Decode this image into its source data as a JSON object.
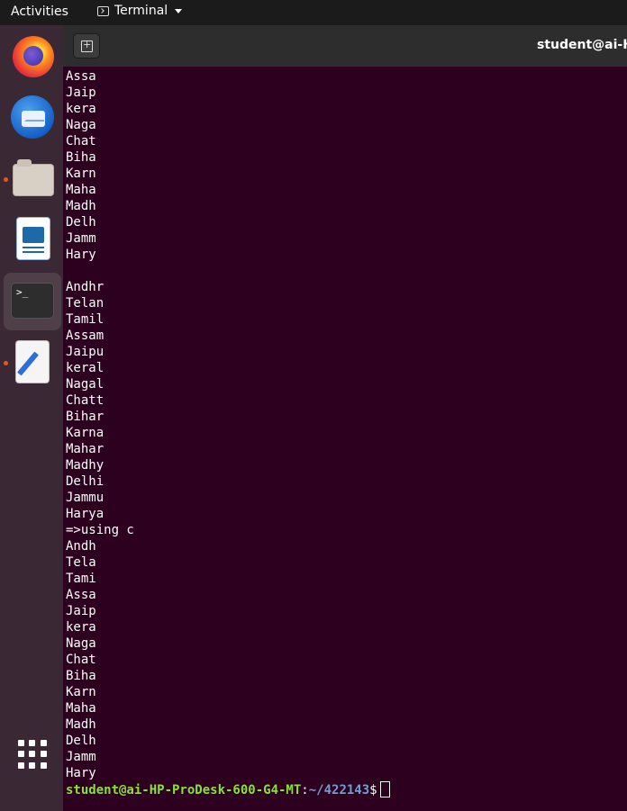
{
  "topbar": {
    "activities": "Activities",
    "app_name": "Terminal"
  },
  "dock": {
    "items": [
      {
        "name": "Firefox",
        "icon": "firefox-icon",
        "running": false
      },
      {
        "name": "Thunderbird",
        "icon": "thunderbird-icon",
        "running": false
      },
      {
        "name": "Files",
        "icon": "folder-icon",
        "running": true
      },
      {
        "name": "LibreOffice Writer",
        "icon": "writer-icon",
        "running": false
      },
      {
        "name": "Terminal",
        "icon": "terminal-icon",
        "running": true,
        "active": true
      },
      {
        "name": "Text Editor",
        "icon": "text-editor-icon",
        "running": true
      }
    ],
    "show_apps_icon": "grid-icon",
    "terminal_glyph": ">_"
  },
  "header": {
    "title": "student@ai-H"
  },
  "terminal": {
    "lines": [
      "Assa",
      "Jaip",
      "kera",
      "Naga",
      "Chat",
      "Biha",
      "Karn",
      "Maha",
      "Madh",
      "Delh",
      "Jamm",
      "Hary",
      "",
      "Andhr",
      "Telan",
      "Tamil",
      "Assam",
      "Jaipu",
      "keral",
      "Nagal",
      "Chatt",
      "Bihar",
      "Karna",
      "Mahar",
      "Madhy",
      "Delhi",
      "Jammu",
      "Harya",
      "=>using c",
      "Andh",
      "Tela",
      "Tami",
      "Assa",
      "Jaip",
      "kera",
      "Naga",
      "Chat",
      "Biha",
      "Karn",
      "Maha",
      "Madh",
      "Delh",
      "Jamm",
      "Hary"
    ],
    "prompt": {
      "user_host": "student@ai-HP-ProDesk-600-G4-MT",
      "colon": ":",
      "path": "~/422143",
      "dollar": "$"
    }
  },
  "colors": {
    "terminal_bg": "#2c001e",
    "prompt_user": "#8ae234",
    "prompt_path": "#729fcf",
    "accent": "#e95420"
  }
}
